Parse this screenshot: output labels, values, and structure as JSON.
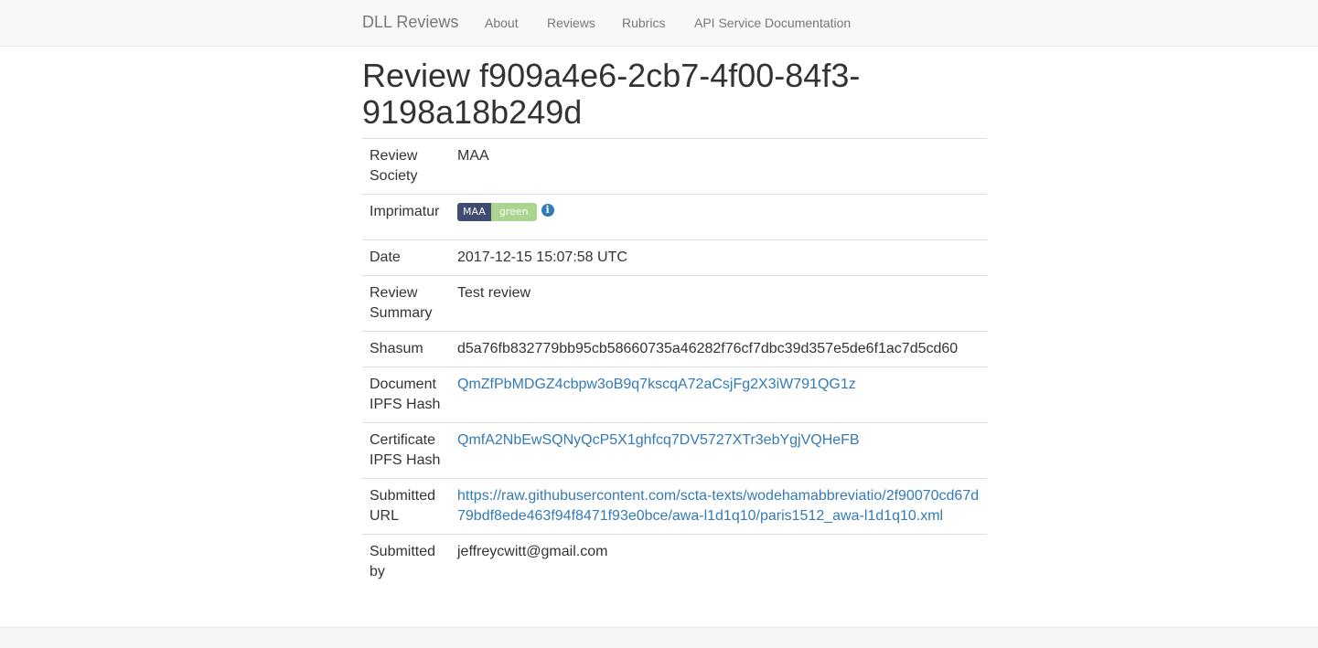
{
  "navbar": {
    "brand": "DLL Reviews",
    "links": [
      "About",
      "Reviews",
      "Rubrics",
      "API Service Documentation"
    ]
  },
  "page": {
    "title": "Review f909a4e6-2cb7-4f00-84f3-9198a18b249d"
  },
  "review": {
    "society_label": "Review Society",
    "society": "MAA",
    "imprimatur_label": "Imprimatur",
    "imprimatur_badge_left": "MAA",
    "imprimatur_badge_right": "green",
    "imprimatur_info": "i",
    "date_label": "Date",
    "date": "2017-12-15 15:07:58 UTC",
    "summary_label": "Review Summary",
    "summary": "Test review",
    "shasum_label": "Shasum",
    "shasum": "d5a76fb832779bb95cb58660735a46282f76cf7dbc39d357e5de6f1ac7d5cd60",
    "doc_hash_label": "Document IPFS Hash",
    "doc_hash": "QmZfPbMDGZ4cbpw3oB9q7kscqA72aCsjFg2X3iW791QG1z",
    "cert_hash_label": "Certificate IPFS Hash",
    "cert_hash": "QmfA2NbEwSQNyQcP5X1ghfcq7DV5727XTr3ebYgjVQHeFB",
    "url_label": "Submitted URL",
    "url": "https://raw.githubusercontent.com/scta-texts/wodehamabbreviatio/2f90070cd67d79bdf8ede463f94f8471f93e0bce/awa-l1d1q10/paris1512_awa-l1d1q10.xml",
    "submitted_by_label": "Submitted by",
    "submitted_by": "jeffreycwitt@gmail.com"
  },
  "colors": {
    "link": "#337ab7",
    "badge_left": "#414a70",
    "badge_right": "#a9d68c"
  }
}
